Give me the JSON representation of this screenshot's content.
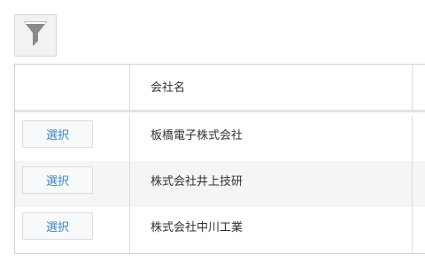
{
  "toolbar": {
    "filter_icon": "filter-funnel-icon"
  },
  "table": {
    "column_header": "会社名",
    "select_label": "選択",
    "rows": [
      {
        "company": "板橋電子株式会社"
      },
      {
        "company": "株式会社井上技研"
      },
      {
        "company": "株式会社中川工業"
      }
    ]
  },
  "colors": {
    "link_blue": "#3d86c6",
    "icon_gray": "#8a8a8a",
    "alt_row": "#f5f5f5",
    "border": "#d0d0d0"
  }
}
